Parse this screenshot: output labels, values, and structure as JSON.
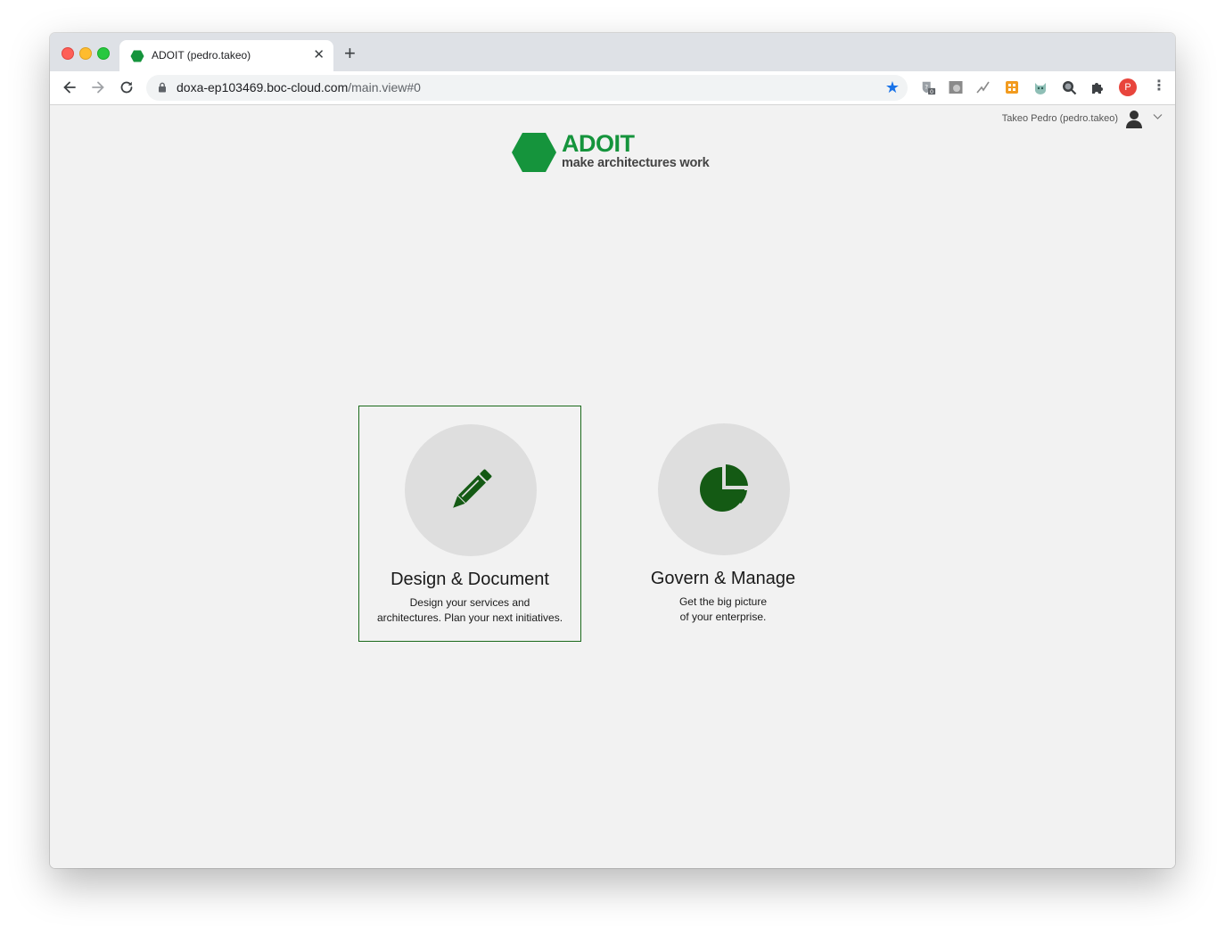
{
  "browser": {
    "tab": {
      "title": "ADOIT (pedro.takeo)",
      "close_glyph": "✕"
    },
    "new_tab_glyph": "+",
    "url": {
      "host": "doxa-ep103469.boc-cloud.com",
      "path": "/main.view#0"
    },
    "extension_badge": "0",
    "profile_initial": "P"
  },
  "header": {
    "user_label": "Takeo Pedro (pedro.takeo)"
  },
  "logo": {
    "title": "ADOIT",
    "tagline": "make architectures work",
    "color": "#15943c"
  },
  "cards": [
    {
      "title": "Design & Document",
      "desc_line1": "Design your services and",
      "desc_line2": "architectures. Plan your next initiatives.",
      "icon": "pencil-icon",
      "selected": true
    },
    {
      "title": "Govern & Manage",
      "desc_line1": "Get the big picture",
      "desc_line2": "of your enterprise.",
      "icon": "pie-chart-icon",
      "selected": false
    }
  ],
  "colors": {
    "accent": "#15943c",
    "icon_green": "#145a14",
    "selection_border": "#1b6a1b"
  }
}
